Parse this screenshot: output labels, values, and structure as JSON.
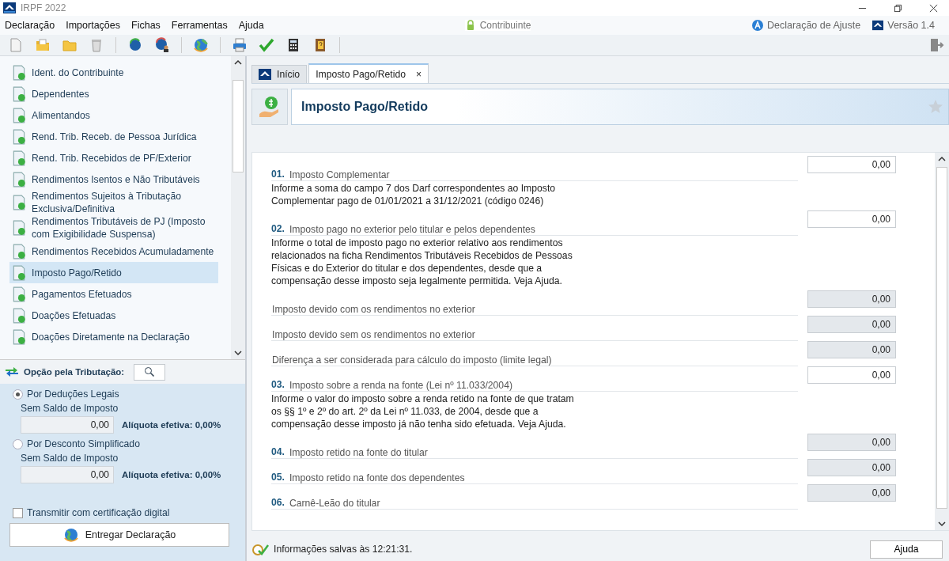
{
  "window": {
    "title": "IRPF 2022"
  },
  "menu": [
    "Declaração",
    "Importações",
    "Fichas",
    "Ferramentas",
    "Ajuda"
  ],
  "header_status": {
    "user": "Contribuinte",
    "mode": "Declaração de Ajuste",
    "version": "Versão 1.4"
  },
  "sidebar": {
    "items": [
      {
        "label": "Ident. do Contribuinte",
        "selected": false
      },
      {
        "label": "Dependentes",
        "selected": false
      },
      {
        "label": "Alimentandos",
        "selected": false
      },
      {
        "label": "Rend. Trib. Receb. de Pessoa Jurídica",
        "selected": false
      },
      {
        "label": "Rend. Trib. Recebidos de PF/Exterior",
        "selected": false
      },
      {
        "label": "Rendimentos Isentos e Não Tributáveis",
        "selected": false
      },
      {
        "label": "Rendimentos Sujeitos à Tributação Exclusiva/Definitiva",
        "selected": false
      },
      {
        "label": "Rendimentos Tributáveis de PJ (Imposto com Exigibilidade Suspensa)",
        "selected": false
      },
      {
        "label": "Rendimentos Recebidos Acumuladamente",
        "selected": false
      },
      {
        "label": "Imposto Pago/Retido",
        "selected": true
      },
      {
        "label": "Pagamentos Efetuados",
        "selected": false
      },
      {
        "label": "Doações Efetuadas",
        "selected": false
      },
      {
        "label": "Doações Diretamente na Declaração",
        "selected": false
      }
    ]
  },
  "taxation": {
    "title": "Opção pela Tributação:",
    "options": [
      {
        "label": "Por Deduções Legais",
        "selected": true,
        "sublabel": "Sem Saldo de Imposto",
        "value": "0,00",
        "rate": "Alíquota efetiva: 0,00%"
      },
      {
        "label": "Por Desconto Simplificado",
        "selected": false,
        "sublabel": "Sem Saldo de Imposto",
        "value": "0,00",
        "rate": "Alíquota efetiva: 0,00%"
      }
    ],
    "digital_certificate": {
      "label": "Transmitir com certificação digital",
      "checked": false
    },
    "submit_button": "Entregar Declaração"
  },
  "tabs": [
    {
      "label": "Início",
      "selected": false,
      "closable": false
    },
    {
      "label": "Imposto Pago/Retido",
      "selected": true,
      "closable": true
    }
  ],
  "close_tab_glyph": "×",
  "page_title": "Imposto Pago/Retido",
  "form_rows": [
    {
      "number": "01.",
      "label": "Imposto Complementar",
      "value": "0,00",
      "editable": true,
      "help": "Informe a soma do campo 7 dos Darf correspondentes ao Imposto Complementar pago de 01/01/2021 a 31/12/2021 (código 0246)"
    },
    {
      "number": "02.",
      "label": "Imposto pago no exterior pelo titular e pelos dependentes",
      "value": "0,00",
      "editable": true,
      "help": "Informe o total de imposto pago no exterior relativo aos rendimentos relacionados na ficha Rendimentos Tributáveis Recebidos de Pessoas Físicas e do Exterior do titular e dos dependentes, desde que a compensação desse imposto seja legalmente permitida. Veja Ajuda."
    },
    {
      "label": "Imposto devido com os rendimentos no exterior",
      "value": "0,00",
      "editable": false
    },
    {
      "label": "Imposto devido sem os rendimentos no exterior",
      "value": "0,00",
      "editable": false
    },
    {
      "label": "Diferença a ser considerada para cálculo do imposto (limite legal)",
      "value": "0,00",
      "editable": false
    },
    {
      "number": "03.",
      "label": "Imposto sobre a renda na fonte (Lei nº 11.033/2004)",
      "value": "0,00",
      "editable": true,
      "help": "Informe o valor do imposto sobre a renda retido na fonte de que tratam os §§ 1º e 2º do art. 2º da Lei nº 11.033, de 2004, desde que a compensação desse imposto já não tenha sido efetuada. Veja Ajuda."
    },
    {
      "number": "04.",
      "label": "Imposto retido na fonte do titular",
      "value": "0,00",
      "editable": false
    },
    {
      "number": "05.",
      "label": "Imposto retido na fonte dos dependentes",
      "value": "0,00",
      "editable": false
    },
    {
      "number": "06.",
      "label": "Carnê-Leão do titular",
      "value": "0,00",
      "editable": false
    }
  ],
  "status_bar": {
    "message": "Informações salvas às 12:21:31.",
    "help_button": "Ajuda"
  }
}
